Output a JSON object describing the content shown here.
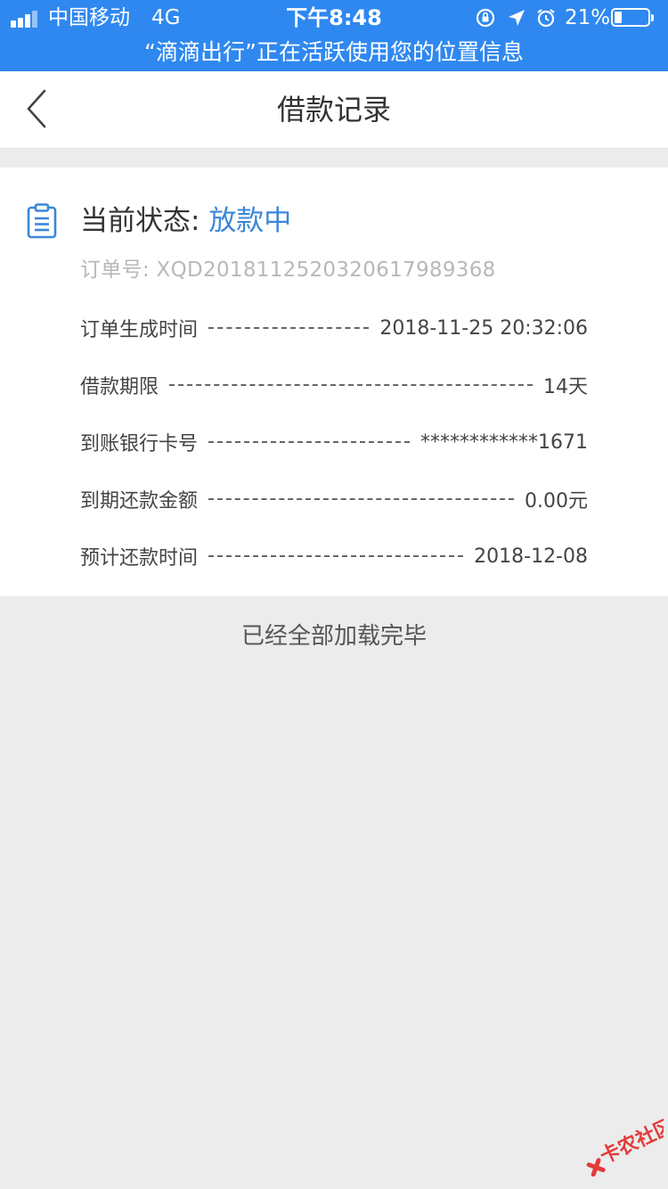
{
  "status_bar": {
    "carrier": "中国移动",
    "network": "4G",
    "time": "下午8:48",
    "battery_percent": "21%",
    "location_banner": "“滴滴出行”正在活跃使用您的位置信息",
    "background_color": "#2f88f0"
  },
  "nav": {
    "title": "借款记录"
  },
  "record": {
    "status_label": "当前状态: ",
    "status_value": "放款中",
    "status_color": "#3a87d9",
    "order_no": "订单号: XQD20181125203206179893​68",
    "details": [
      {
        "label": "订单生成时间",
        "value": "2018-11-25 20:32:06"
      },
      {
        "label": "借款期限",
        "value": "14天"
      },
      {
        "label": "到账银行卡号",
        "value": "************1671"
      },
      {
        "label": "到期还款金额",
        "value": "0.00元"
      },
      {
        "label": "预计还款时间",
        "value": "2018-12-08"
      }
    ]
  },
  "footer": {
    "end_message": "已经全部加载完毕"
  },
  "watermark": {
    "text": "卡农社区"
  }
}
